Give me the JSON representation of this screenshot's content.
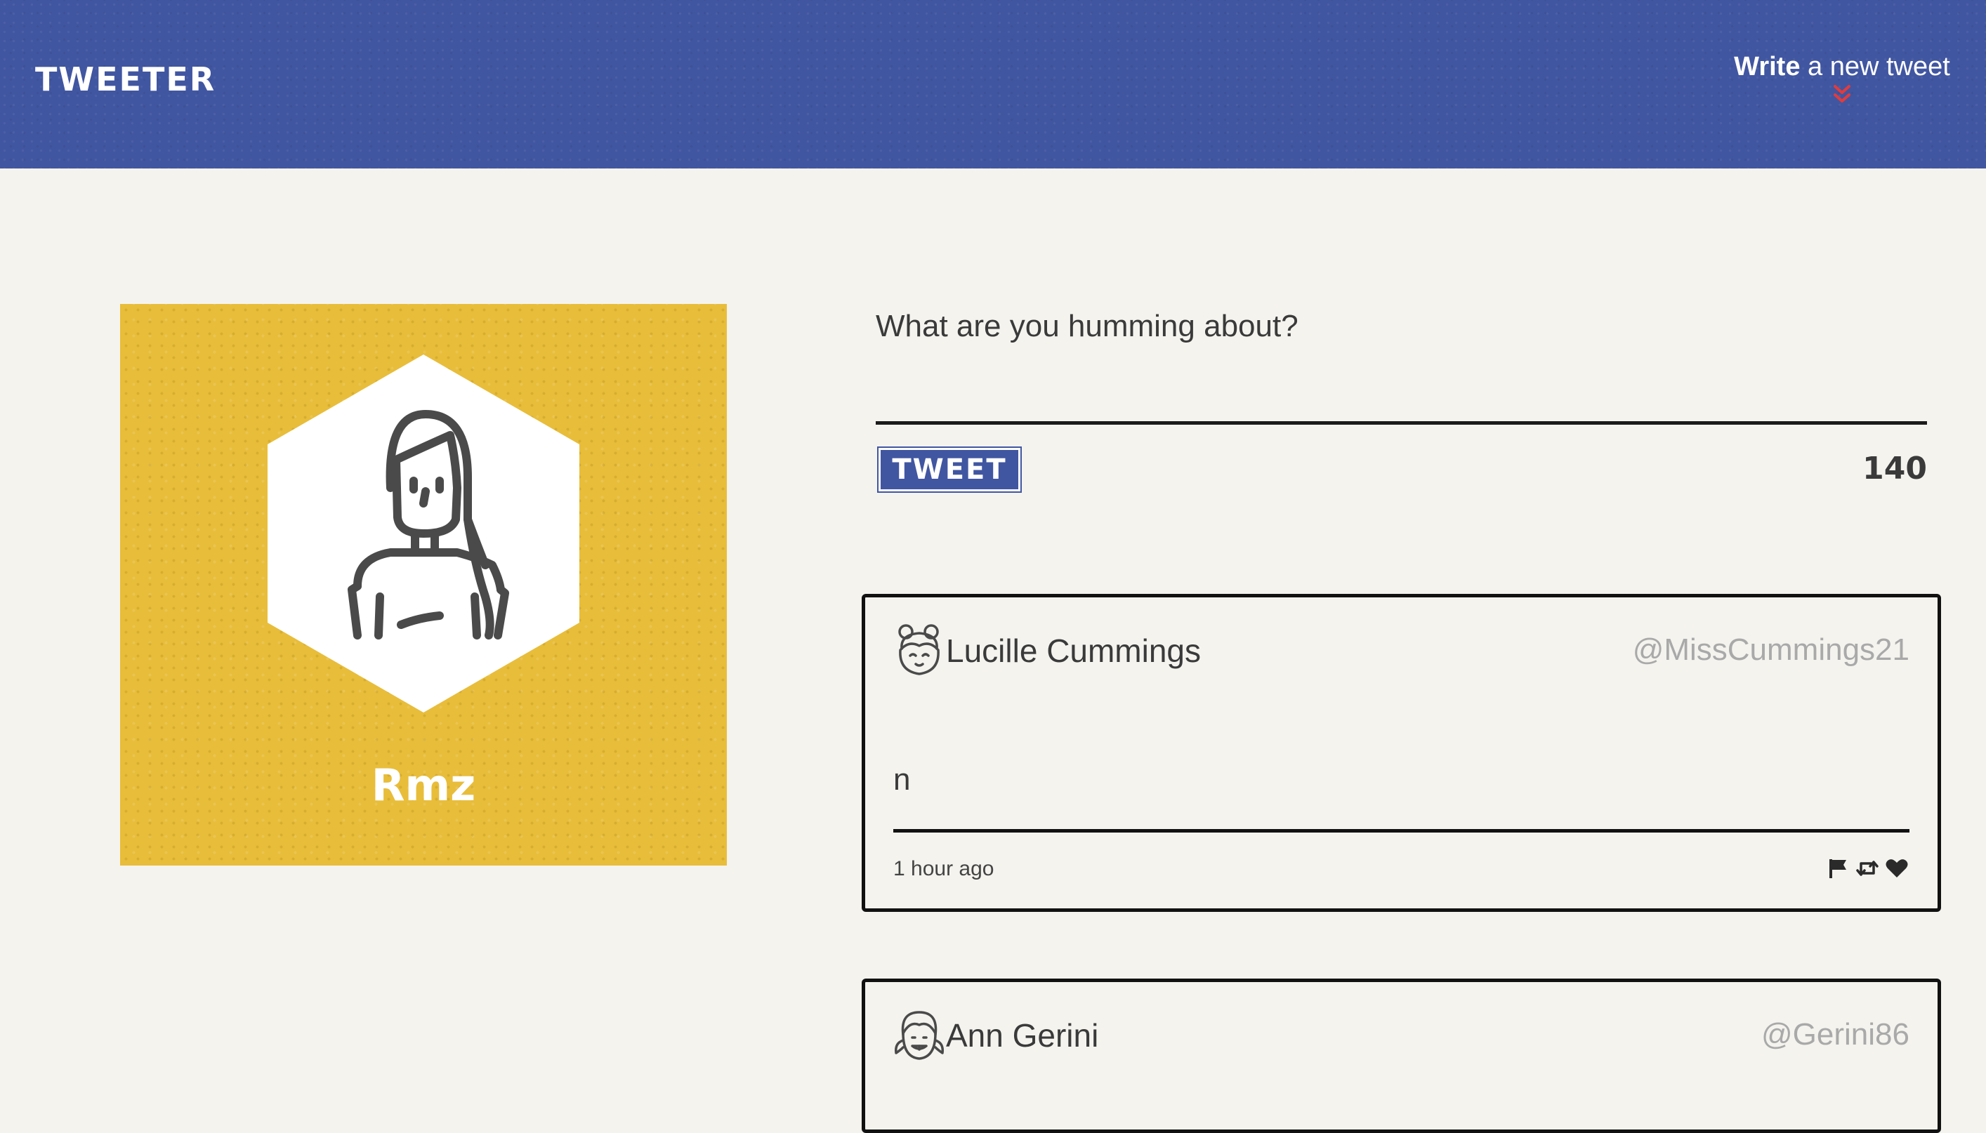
{
  "nav": {
    "brand": "TWEETER",
    "compose_toggle": {
      "strong": "Write",
      "rest": " a new tweet",
      "chevron_icon": "double-chevron-down",
      "chevron_color": "#e33b3b"
    },
    "background_color": "#4156a1"
  },
  "profile": {
    "name": "Rmz",
    "avatar_icon": "woman-avatar",
    "card_color": "#e8bd3a"
  },
  "compose": {
    "placeholder": "What are you humming about?",
    "submit_label": "TWEET",
    "char_count": "140"
  },
  "tweets": [
    {
      "name": "Lucille Cummings",
      "handle": "@MissCummings21",
      "avatar_icon": "girl-buns-avatar",
      "content": "n",
      "timestamp": "1 hour ago",
      "actions": [
        "flag-icon",
        "retweet-icon",
        "heart-icon"
      ]
    },
    {
      "name": "Ann Gerini",
      "handle": "@Gerini86",
      "avatar_icon": "girl-pigtails-avatar"
    }
  ]
}
